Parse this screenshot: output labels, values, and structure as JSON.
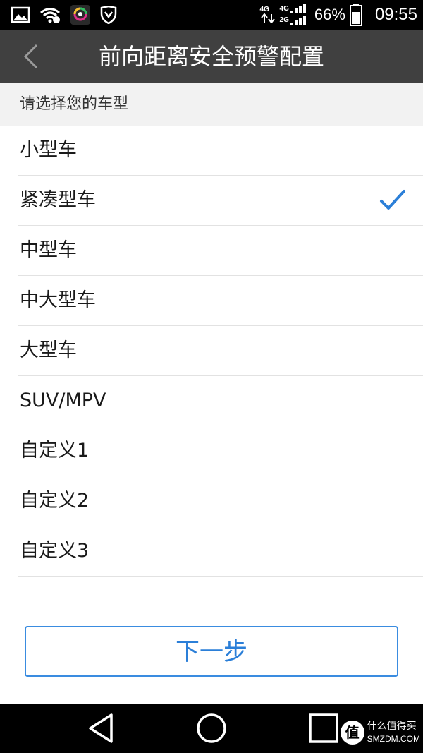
{
  "status_bar": {
    "icons": [
      "image-icon",
      "wifi-icon",
      "app-icon",
      "shield-icon"
    ],
    "network_1": "4G",
    "network_2": "4G",
    "network_3": "2G",
    "battery": "66%",
    "time": "09:55"
  },
  "header": {
    "title": "前向距离安全预警配置"
  },
  "section": {
    "label": "请选择您的车型"
  },
  "vehicle_types": [
    {
      "label": "小型车",
      "selected": false
    },
    {
      "label": "紧凑型车",
      "selected": true
    },
    {
      "label": "中型车",
      "selected": false
    },
    {
      "label": "中大型车",
      "selected": false
    },
    {
      "label": "大型车",
      "selected": false
    },
    {
      "label": "SUV/MPV",
      "selected": false
    },
    {
      "label": "自定义1",
      "selected": false
    },
    {
      "label": "自定义2",
      "selected": false
    },
    {
      "label": "自定义3",
      "selected": false
    }
  ],
  "next_button": {
    "label": "下一步"
  },
  "watermark": {
    "logo": "值",
    "line1": "什么值得买",
    "line2": "SMZDM.COM"
  },
  "colors": {
    "accent": "#2b7fd8",
    "header_bg": "#404040",
    "section_bg": "#f2f2f2"
  }
}
